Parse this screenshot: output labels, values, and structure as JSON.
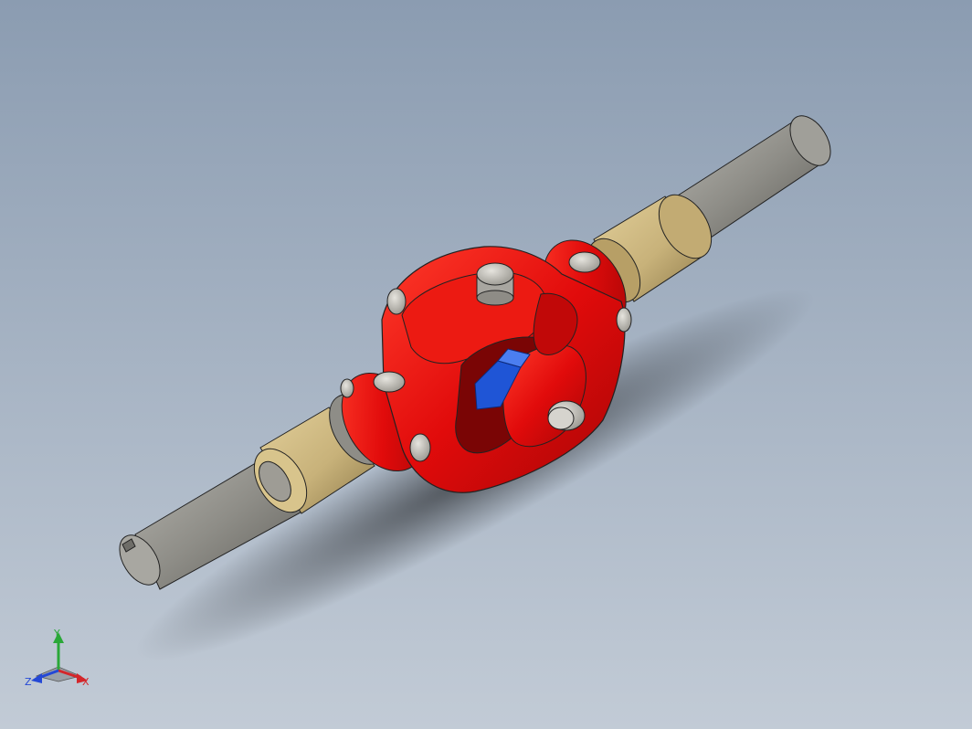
{
  "viewport": {
    "background_top": "#8b9cb1",
    "background_bottom": "#c2cbd6"
  },
  "model": {
    "shaft_color": "#8e8d87",
    "bushing_color": "#c8b27a",
    "yoke_color": "#e10b0b",
    "cross_color": "#1f55d6",
    "pin_color": "#c9c7c1"
  },
  "triad": {
    "x_label": "X",
    "y_label": "Y",
    "z_label": "Z",
    "x_color": "#d4262a",
    "y_color": "#2aa838",
    "z_color": "#2448d6"
  }
}
